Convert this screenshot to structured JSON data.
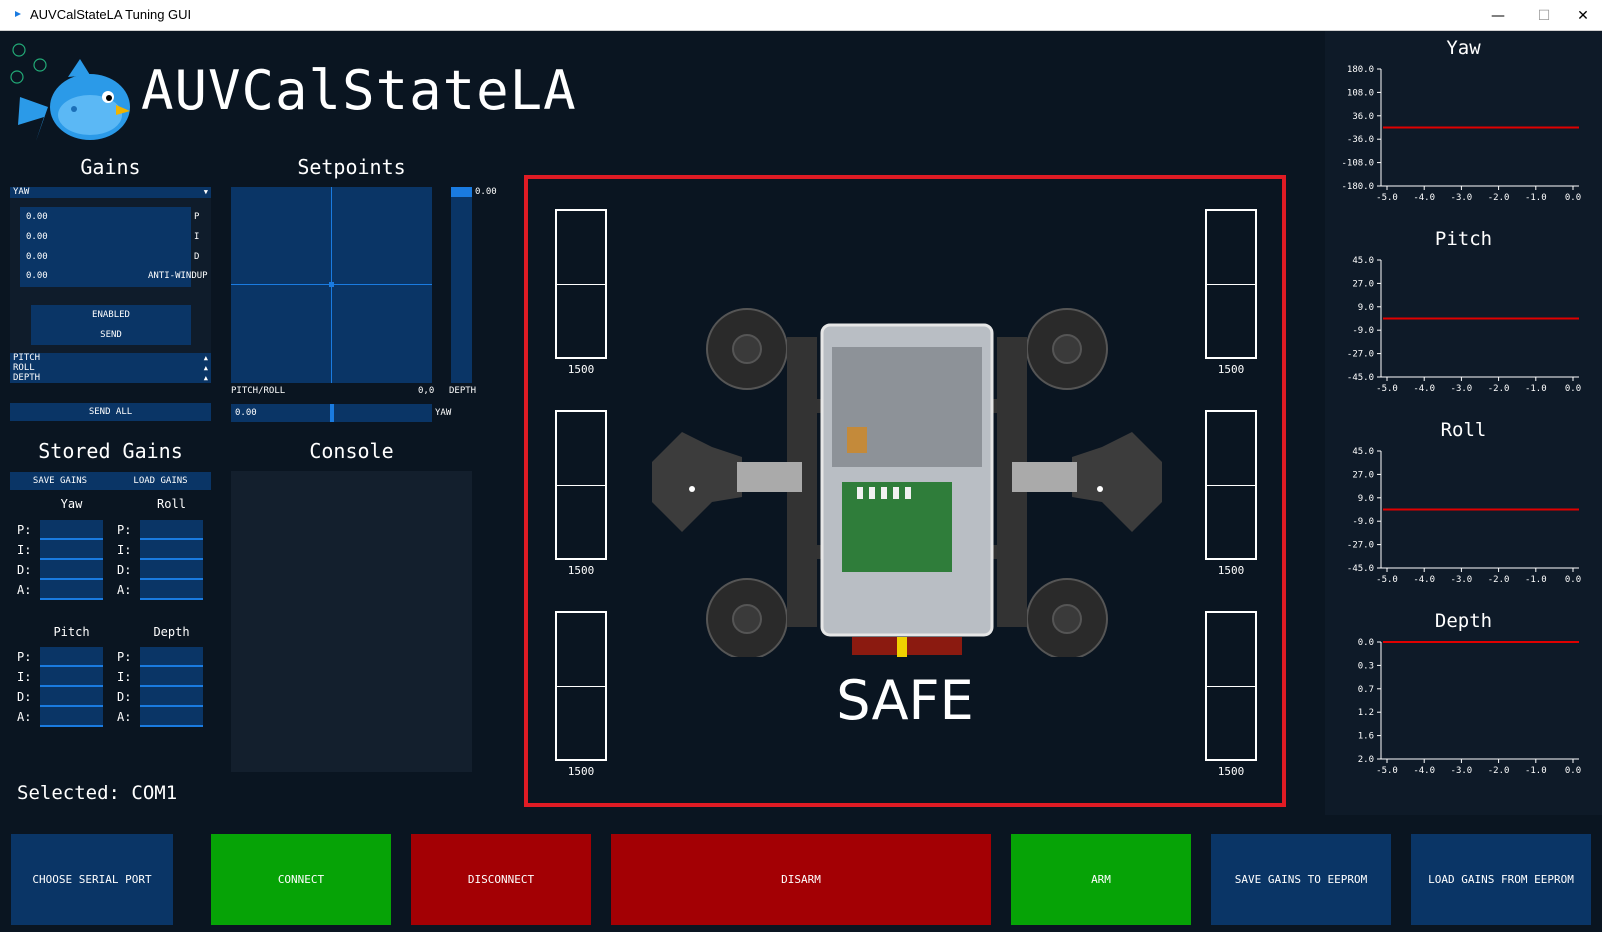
{
  "window": {
    "title": "AUVCalStateLA Tuning GUI",
    "minimize": "—",
    "maximize": "☐",
    "close": "✕"
  },
  "brand": "AUVCalStateLA",
  "gains": {
    "title": "Gains",
    "selected_axis": "YAW",
    "p_value": "0.00",
    "i_value": "0.00",
    "d_value": "0.00",
    "aw_value": "0.00",
    "p_label": "P",
    "i_label": "I",
    "d_label": "D",
    "aw_label": "ANTI-WINDUP",
    "enabled_label": "ENABLED",
    "send_label": "SEND",
    "collapsed": [
      "PITCH",
      "ROLL",
      "DEPTH"
    ],
    "send_all_label": "SEND ALL"
  },
  "setpoints": {
    "title": "Setpoints",
    "pitch_roll_label": "PITCH/ROLL",
    "pitch_roll_value": "0,0",
    "depth_label": "DEPTH",
    "depth_value": "0.00",
    "yaw_label": "YAW",
    "yaw_value": "0.00",
    "depth_level": 0.05,
    "yaw_level": 0.5
  },
  "stored_gains": {
    "title": "Stored Gains",
    "save_label": "SAVE GAINS",
    "load_label": "LOAD GAINS",
    "groups": [
      {
        "name": "Yaw",
        "rows": [
          "P:",
          "I:",
          "D:",
          "A:"
        ]
      },
      {
        "name": "Roll",
        "rows": [
          "P:",
          "I:",
          "D:",
          "A:"
        ]
      },
      {
        "name": "Pitch",
        "rows": [
          "P:",
          "I:",
          "D:",
          "A:"
        ]
      },
      {
        "name": "Depth",
        "rows": [
          "P:",
          "I:",
          "D:",
          "A:"
        ]
      }
    ]
  },
  "console": {
    "title": "Console"
  },
  "status": {
    "selected": "Selected: COM1"
  },
  "robot": {
    "state": "SAFE",
    "motors": [
      "1500",
      "1500",
      "1500",
      "1500",
      "1500",
      "1500"
    ]
  },
  "graphs": [
    {
      "title": "Yaw",
      "yticks": [
        "180.0",
        "108.0",
        "36.0",
        "-36.0",
        "-108.0",
        "-180.0"
      ],
      "xticks": [
        "-5.0",
        "-4.0",
        "-3.0",
        "-2.0",
        "-1.0",
        "0.0"
      ],
      "value_level": 0.5
    },
    {
      "title": "Pitch",
      "yticks": [
        "45.0",
        "27.0",
        "9.0",
        "-9.0",
        "-27.0",
        "-45.0"
      ],
      "xticks": [
        "-5.0",
        "-4.0",
        "-3.0",
        "-2.0",
        "-1.0",
        "0.0"
      ],
      "value_level": 0.5
    },
    {
      "title": "Roll",
      "yticks": [
        "45.0",
        "27.0",
        "9.0",
        "-9.0",
        "-27.0",
        "-45.0"
      ],
      "xticks": [
        "-5.0",
        "-4.0",
        "-3.0",
        "-2.0",
        "-1.0",
        "0.0"
      ],
      "value_level": 0.5
    },
    {
      "title": "Depth",
      "yticks": [
        "0.0",
        "0.3",
        "0.7",
        "1.2",
        "1.6",
        "2.0"
      ],
      "xticks": [
        "-5.0",
        "-4.0",
        "-3.0",
        "-2.0",
        "-1.0",
        "0.0"
      ],
      "value_level": 0.0
    }
  ],
  "buttons": {
    "choose_port": "CHOOSE SERIAL PORT",
    "connect": "CONNECT",
    "disconnect": "DISCONNECT",
    "disarm": "DISARM",
    "arm": "ARM",
    "save_eeprom": "SAVE GAINS TO EEPROM",
    "load_eeprom": "LOAD GAINS FROM EEPROM"
  },
  "colors": {
    "background": "#0a1521",
    "panel_blue": "#0a3566",
    "accent_blue": "#1a7be0",
    "green": "#06a306",
    "red": "#a30004",
    "frame_red": "#e01b24",
    "plot_line": "#e00000"
  }
}
